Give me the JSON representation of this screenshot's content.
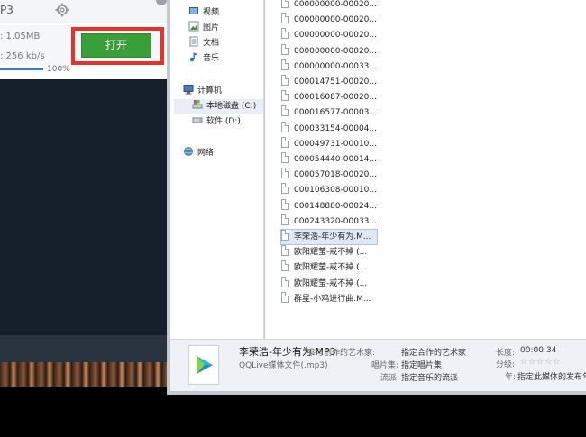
{
  "converter": {
    "format": "P3",
    "size": ": 1.05MB",
    "bitrate": ": 256 kb/s",
    "open_button": "打开",
    "progress_label": "100%",
    "progress": 1.0
  },
  "nav": {
    "libraries": [
      "视频",
      "图片",
      "文档",
      "音乐"
    ],
    "computer": "计算机",
    "drives": [
      "本地磁盘 (C:)",
      "软件 (D:)"
    ],
    "network": "网络"
  },
  "files": [
    "000000000-00020...",
    "000000000-00020...",
    "000000000-00020...",
    "000000000-00020...",
    "000000000-00033...",
    "000014751-00020...",
    "000016087-00020...",
    "000016577-00003...",
    "000033154-00004...",
    "000049731-00010...",
    "000054440-00014...",
    "000057018-00020...",
    "000106308-00010...",
    "000148880-00024...",
    "000243320-00033...",
    "李荣浩-年少有为.M...",
    "欧阳耀莹-戒不掉 (...",
    "欧阳耀莹-戒不掉 (...",
    "欧阳耀莹-戒不掉 (...",
    "群星-小鸡进行曲.M..."
  ],
  "selected_file_index": 15,
  "details": {
    "name": "李荣浩-年少有为.MP3",
    "type": "QQLive媒体文件(.mp3)",
    "artist_label": "参与创作的艺术家:",
    "artist_value": "指定合作的艺术家",
    "album_label": "唱片集:",
    "album_value": "指定唱片集",
    "genre_label": "流派:",
    "genre_value": "指定音乐的流派",
    "length_label": "长度:",
    "length_value": "00:00:34",
    "rating_label": "分级:",
    "rating_stars": 0,
    "year_label": "年:",
    "year_value": "指定此媒体的发布年"
  },
  "colors": {
    "open_button": "#39a039",
    "highlight_frame": "#e5332c",
    "progress": "#2d7ee6",
    "selection": "#dfe9f5"
  }
}
